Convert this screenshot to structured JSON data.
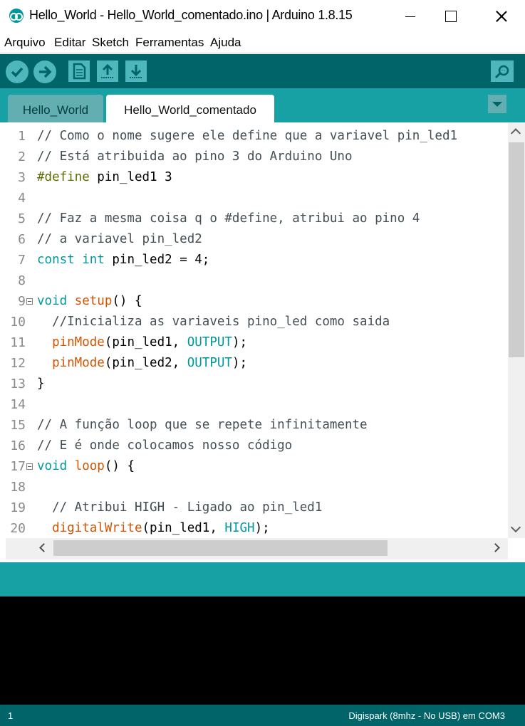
{
  "window": {
    "title": "Hello_World - Hello_World_comentado.ino | Arduino 1.8.15"
  },
  "menu": {
    "items": [
      "Arquivo",
      "Editar",
      "Sketch",
      "Ferramentas",
      "Ajuda"
    ]
  },
  "toolbar": {
    "buttons": [
      "verify-icon",
      "upload-icon",
      "new-icon",
      "open-icon",
      "save-icon",
      "serial-monitor-icon"
    ]
  },
  "tabs": [
    {
      "label": "Hello_World",
      "active": false
    },
    {
      "label": "Hello_World_comentado",
      "active": true
    }
  ],
  "editor": {
    "line_numbers": [
      "1",
      "2",
      "3",
      "4",
      "5",
      "6",
      "7",
      "8",
      "9",
      "10",
      "11",
      "12",
      "13",
      "14",
      "15",
      "16",
      "17",
      "18",
      "19",
      "20"
    ],
    "lines": [
      [
        {
          "t": "// Como o nome sugere ele define que a variavel pin_led1",
          "c": "com"
        }
      ],
      [
        {
          "t": "// Está atribuida ao pino 3 do Arduino Uno",
          "c": "com"
        }
      ],
      [
        {
          "t": "#define",
          "c": "pre"
        },
        {
          "t": " pin_led1 3",
          "c": ""
        }
      ],
      [
        {
          "t": "",
          "c": ""
        }
      ],
      [
        {
          "t": "// Faz a mesma coisa q o #define, atribui ao pino 4",
          "c": "com"
        }
      ],
      [
        {
          "t": "// a variavel pin_led2",
          "c": "com"
        }
      ],
      [
        {
          "t": "const",
          "c": "kw"
        },
        {
          "t": " ",
          "c": ""
        },
        {
          "t": "int",
          "c": "kw"
        },
        {
          "t": " pin_led2 = 4;",
          "c": ""
        }
      ],
      [
        {
          "t": "",
          "c": ""
        }
      ],
      [
        {
          "t": "void",
          "c": "kw"
        },
        {
          "t": " ",
          "c": ""
        },
        {
          "t": "setup",
          "c": "fn"
        },
        {
          "t": "() {",
          "c": ""
        }
      ],
      [
        {
          "t": "  //Inicializa as variaveis pino_led como saida",
          "c": "com"
        }
      ],
      [
        {
          "t": "  ",
          "c": ""
        },
        {
          "t": "pinMode",
          "c": "fn"
        },
        {
          "t": "(pin_led1, ",
          "c": ""
        },
        {
          "t": "OUTPUT",
          "c": "const"
        },
        {
          "t": ");",
          "c": ""
        }
      ],
      [
        {
          "t": "  ",
          "c": ""
        },
        {
          "t": "pinMode",
          "c": "fn"
        },
        {
          "t": "(pin_led2, ",
          "c": ""
        },
        {
          "t": "OUTPUT",
          "c": "const"
        },
        {
          "t": ");",
          "c": ""
        }
      ],
      [
        {
          "t": "}",
          "c": ""
        }
      ],
      [
        {
          "t": "",
          "c": ""
        }
      ],
      [
        {
          "t": "// A função loop que se repete infinitamente",
          "c": "com"
        }
      ],
      [
        {
          "t": "// E é onde colocamos nosso código",
          "c": "com"
        }
      ],
      [
        {
          "t": "void",
          "c": "kw"
        },
        {
          "t": " ",
          "c": ""
        },
        {
          "t": "loop",
          "c": "fn"
        },
        {
          "t": "() {",
          "c": ""
        }
      ],
      [
        {
          "t": "",
          "c": ""
        }
      ],
      [
        {
          "t": "  // Atribui HIGH - Ligado ao pin_led1",
          "c": "com"
        }
      ],
      [
        {
          "t": "  ",
          "c": ""
        },
        {
          "t": "digitalWrite",
          "c": "fn"
        },
        {
          "t": "(pin_led1, ",
          "c": ""
        },
        {
          "t": "HIGH",
          "c": "const"
        },
        {
          "t": ");",
          "c": ""
        }
      ]
    ],
    "fold_lines": [
      9,
      17
    ]
  },
  "status": {
    "line_indicator": "1",
    "board_info": "Digispark (8mhz - No USB) em COM3"
  },
  "colors": {
    "toolbar": "#006468",
    "tabbar": "#17a1a5",
    "comment": "#434f54",
    "keyword": "#00979c",
    "function": "#d35400",
    "preprocessor": "#5e6d03"
  }
}
